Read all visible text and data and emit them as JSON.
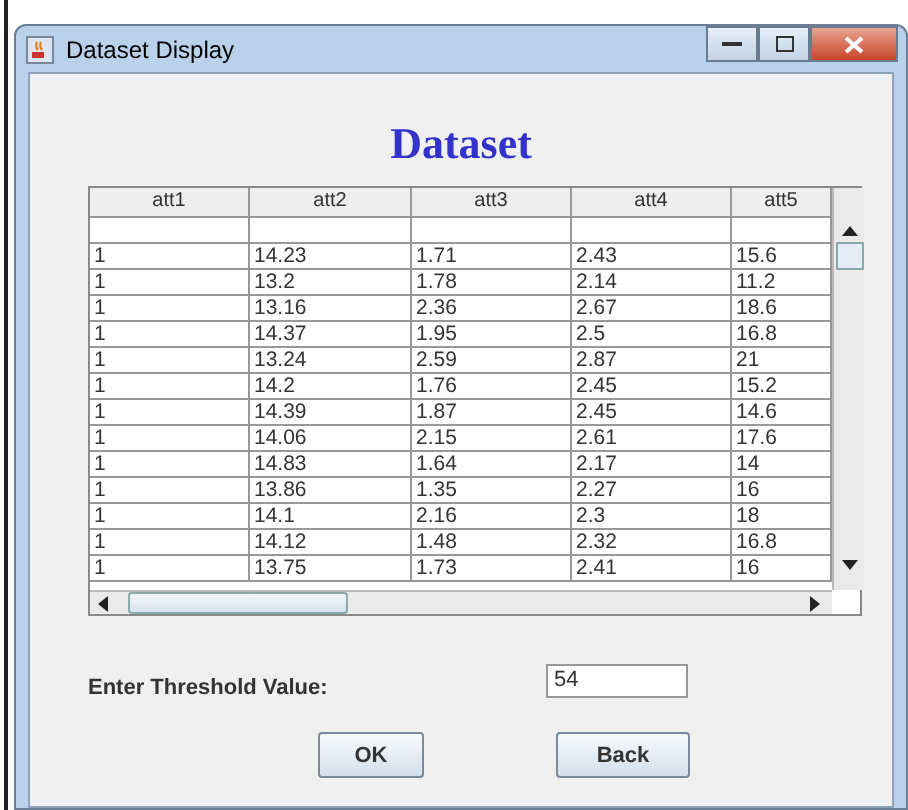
{
  "window": {
    "title": "Dataset Display"
  },
  "heading": "Dataset",
  "table": {
    "columns": [
      "att1",
      "att2",
      "att3",
      "att4",
      "att5"
    ],
    "rows": [
      [
        "1",
        "14.23",
        "1.71",
        "2.43",
        "15.6"
      ],
      [
        "1",
        "13.2",
        "1.78",
        "2.14",
        "11.2"
      ],
      [
        "1",
        "13.16",
        "2.36",
        "2.67",
        "18.6"
      ],
      [
        "1",
        "14.37",
        "1.95",
        "2.5",
        "16.8"
      ],
      [
        "1",
        "13.24",
        "2.59",
        "2.87",
        "21"
      ],
      [
        "1",
        "14.2",
        "1.76",
        "2.45",
        "15.2"
      ],
      [
        "1",
        "14.39",
        "1.87",
        "2.45",
        "14.6"
      ],
      [
        "1",
        "14.06",
        "2.15",
        "2.61",
        "17.6"
      ],
      [
        "1",
        "14.83",
        "1.64",
        "2.17",
        "14"
      ],
      [
        "1",
        "13.86",
        "1.35",
        "2.27",
        "16"
      ],
      [
        "1",
        "14.1",
        "2.16",
        "2.3",
        "18"
      ],
      [
        "1",
        "14.12",
        "1.48",
        "2.32",
        "16.8"
      ],
      [
        "1",
        "13.75",
        "1.73",
        "2.41",
        "16"
      ]
    ]
  },
  "threshold": {
    "label": "Enter Threshold Value:",
    "value": "54"
  },
  "buttons": [
    "OK",
    "Back"
  ]
}
